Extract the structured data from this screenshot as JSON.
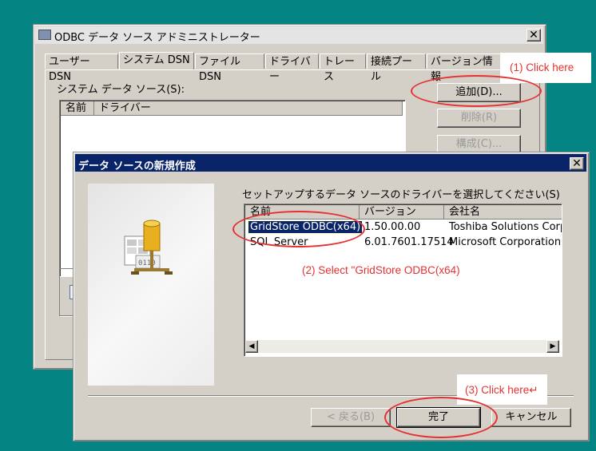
{
  "bg_window": {
    "title": "ODBC データ ソース アドミニストレーター",
    "close_glyph": "✕",
    "tabs": [
      "ユーザー DSN",
      "システム DSN",
      "ファイル DSN",
      "ドライバー",
      "トレース",
      "接続プール",
      "バージョン情報"
    ],
    "section_label": "システム データ ソース(S):",
    "list_headers": [
      "名前",
      "ドライバー"
    ],
    "buttons": {
      "add": "追加(D)...",
      "remove": "削除(R)",
      "configure": "構成(C)..."
    }
  },
  "dialog": {
    "title": "データ ソースの新規作成",
    "close_glyph": "✕",
    "instruction": "セットアップするデータ ソースのドライバーを選択してください(S)",
    "columns": [
      "名前",
      "バージョン",
      "会社名"
    ],
    "rows": [
      {
        "name": "GridStore ODBC(x64)",
        "version": "1.50.00.00",
        "company": "Toshiba Solutions Corp",
        "selected": true
      },
      {
        "name": "SQL Server",
        "version": "6.01.7601.17514",
        "company": "Microsoft Corporation",
        "selected": false
      }
    ],
    "buttons": {
      "back": "< 戻る(B)",
      "finish": "完了",
      "cancel": "キャンセル"
    }
  },
  "annotations": {
    "step1": "(1) Click here",
    "step2": "(2) Select \"GridStore ODBC(x64)",
    "step3": "(3) Click here↵"
  },
  "colors": {
    "desktop": "#058484",
    "annotation": "#e53131",
    "titlebar_active": "#0a246a",
    "selection": "#0a246a"
  }
}
